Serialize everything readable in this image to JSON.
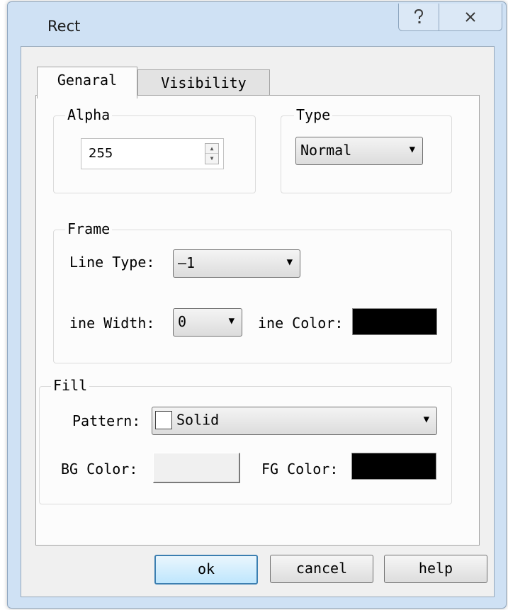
{
  "window": {
    "title": "Rect",
    "help_icon": "question-mark-icon",
    "close_icon": "close-x-icon"
  },
  "tabs": [
    {
      "label": "Genaral",
      "active": true
    },
    {
      "label": "Visibility",
      "active": false
    }
  ],
  "alpha": {
    "group_label": "Alpha",
    "value": "255"
  },
  "type": {
    "group_label": "Type",
    "value": "Normal"
  },
  "frame": {
    "group_label": "Frame",
    "line_type_label": "Line Type:",
    "line_type_value": "—1",
    "line_width_label": "ine Width:",
    "line_width_value": "0",
    "line_color_label": "ine Color:",
    "line_color": "#000000"
  },
  "fill": {
    "group_label": "Fill",
    "pattern_label": "Pattern:",
    "pattern_value": "Solid",
    "bg_color_label": "BG Color:",
    "bg_color": "#f0f0f0",
    "fg_color_label": "FG Color:",
    "fg_color": "#000000"
  },
  "buttons": {
    "ok": "ok",
    "cancel": "cancel",
    "help": "help"
  }
}
